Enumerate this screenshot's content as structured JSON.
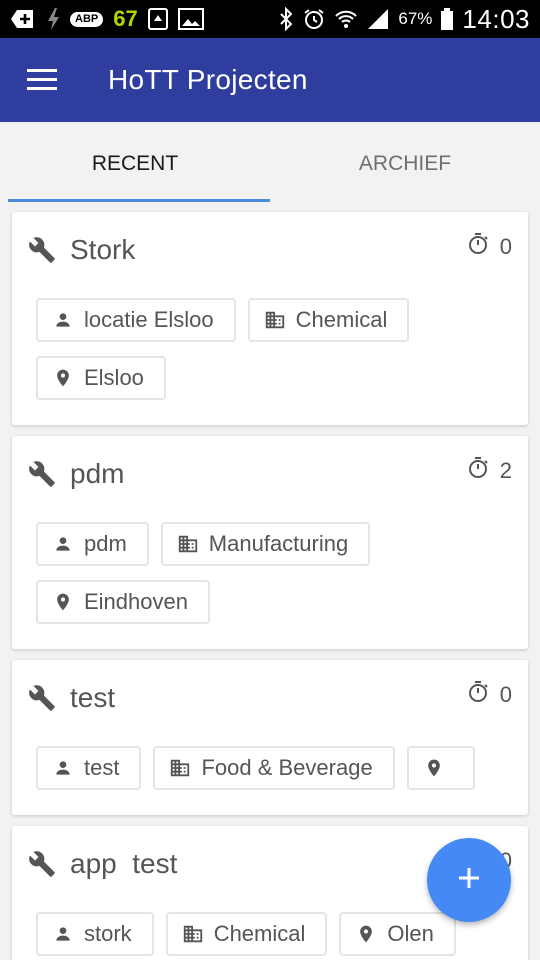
{
  "status_bar": {
    "badge_number": "67",
    "abp_label": "ABP",
    "battery": "67%",
    "time": "14:03"
  },
  "app_bar": {
    "title": "HoTT Projecten"
  },
  "tabs": [
    {
      "label": "RECENT",
      "active": true
    },
    {
      "label": "ARCHIEF",
      "active": false
    }
  ],
  "projects": [
    {
      "title": "Stork",
      "count": "0",
      "contact": "locatie Elsloo",
      "industry": "Chemical",
      "location": "Elsloo"
    },
    {
      "title": "pdm",
      "count": "2",
      "contact": "pdm",
      "industry": "Manufacturing",
      "location": "Eindhoven"
    },
    {
      "title": "test",
      "count": "0",
      "contact": "test",
      "industry": "Food & Beverage",
      "location": ""
    },
    {
      "title": "app  test",
      "count": "0",
      "contact": "stork",
      "industry": "Chemical",
      "location": "Olen"
    }
  ],
  "colors": {
    "app_bar": "#2f3e9e",
    "tab_indicator": "#4a8bdc",
    "fab": "#4489f5"
  },
  "icons": {
    "menu": "hamburger-menu-icon",
    "project": "wrench-icon",
    "timer": "stopwatch-icon",
    "contact": "person-icon",
    "industry": "building-icon",
    "location": "map-pin-icon",
    "fab": "plus-icon"
  }
}
